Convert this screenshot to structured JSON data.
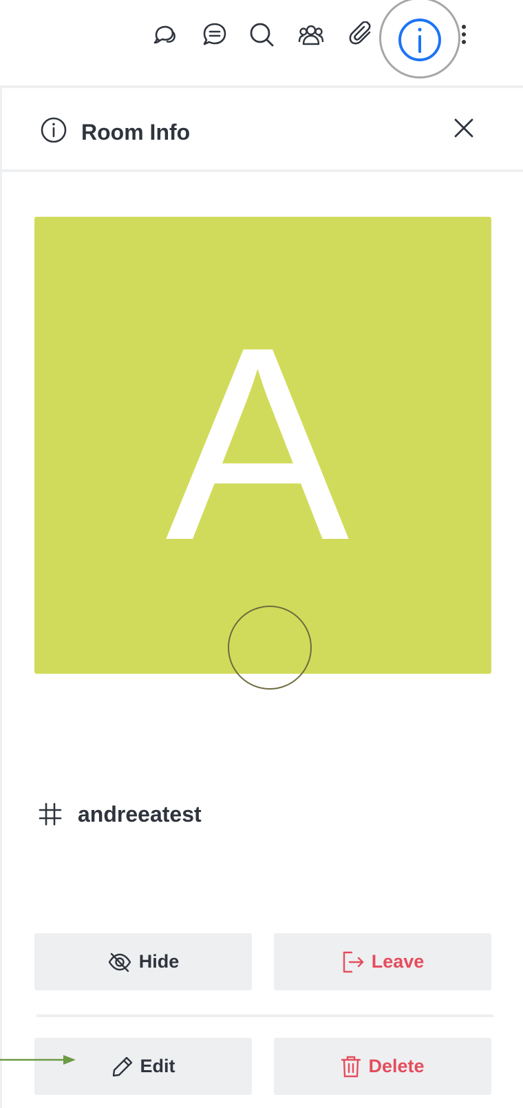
{
  "toolbar": {
    "icons": [
      "threads-icon",
      "discussion-icon",
      "search-icon",
      "members-icon",
      "attachment-icon",
      "info-icon",
      "kebab-menu-icon"
    ],
    "active_icon": "info-icon",
    "active_color": "#1d74f5"
  },
  "panel": {
    "title": "Room Info",
    "title_icon": "info-icon",
    "close_icon": "close-icon"
  },
  "room": {
    "avatar_letter": "A",
    "avatar_color": "#d1db5b",
    "type_icon": "hash-icon",
    "name": "andreeatest"
  },
  "actions": {
    "hide_label": "Hide",
    "leave_label": "Leave",
    "edit_label": "Edit",
    "delete_label": "Delete",
    "danger_color": "#e44d5d"
  },
  "annotation": {
    "arrow_color": "#6c9a45"
  }
}
